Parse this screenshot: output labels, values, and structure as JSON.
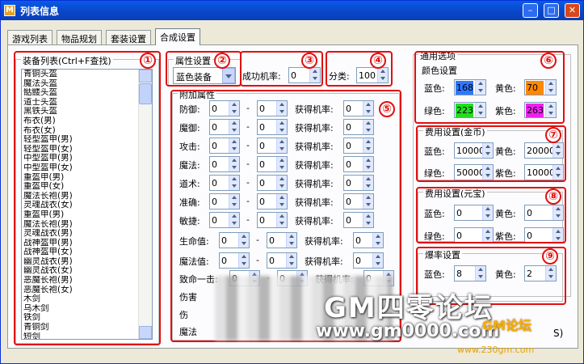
{
  "window": {
    "title": "列表信息",
    "min": "–",
    "max": "□",
    "close": "✕",
    "icon": "app-icon"
  },
  "tabs": [
    {
      "label": "游戏列表",
      "active": false
    },
    {
      "label": "物品规划",
      "active": false
    },
    {
      "label": "套装设置",
      "active": false
    },
    {
      "label": "合成设置",
      "active": true
    }
  ],
  "equip": {
    "label": "装备列表(Ctrl+F查找)",
    "items": [
      "青铜头盔",
      "魔法头盔",
      "骷髅头盔",
      "道士头盔",
      "黑铁头盔",
      "布衣(男)",
      "布衣(女)",
      "轻型盔甲(男)",
      "轻型盔甲(女)",
      "中型盔甲(男)",
      "中型盔甲(女)",
      "重盔甲(男)",
      "重盔甲(女)",
      "魔法长袍(男)",
      "灵魂战衣(女)",
      "重盔甲(男)",
      "魔法长袍(男)",
      "灵魂战衣(男)",
      "战神盔甲(男)",
      "战神盔甲(女)",
      "幽灵战衣(男)",
      "幽灵战衣(女)",
      "恶魔长袍(男)",
      "恶魔长袍(女)",
      "木剑",
      "乌木剑",
      "铁剑",
      "青铜剑",
      "短剑"
    ]
  },
  "attr": {
    "label": "属性设置",
    "combo_value": "蓝色装备"
  },
  "rate": {
    "label": "成功机率:",
    "value": "0"
  },
  "category": {
    "label": "分类:",
    "value": "100"
  },
  "extra": {
    "label": "附加属性",
    "get_label": "获得机率:",
    "rows": [
      {
        "name": "防御:",
        "a": "0",
        "b": "0",
        "p": "0"
      },
      {
        "name": "魔御:",
        "a": "0",
        "b": "0",
        "p": "0"
      },
      {
        "name": "攻击:",
        "a": "0",
        "b": "0",
        "p": "0"
      },
      {
        "name": "魔法:",
        "a": "0",
        "b": "0",
        "p": "0"
      },
      {
        "name": "道术:",
        "a": "0",
        "b": "0",
        "p": "0"
      },
      {
        "name": "准确:",
        "a": "0",
        "b": "0",
        "p": "0"
      },
      {
        "name": "敏捷:",
        "a": "0",
        "b": "0",
        "p": "0"
      },
      {
        "name": "生命值:",
        "a": "0",
        "b": "0",
        "p": "0"
      },
      {
        "name": "魔法值:",
        "a": "0",
        "b": "0",
        "p": "0"
      },
      {
        "name": "致命一击:",
        "a": "0",
        "b": "0",
        "p": "0"
      },
      {
        "name": "伤害",
        "a": "",
        "b": "",
        "p": ""
      },
      {
        "name": "伤",
        "a": "",
        "b": "",
        "p": ""
      },
      {
        "name": "魔法",
        "a": "",
        "b": "",
        "p": ""
      }
    ]
  },
  "general": {
    "label": "通用选项",
    "color_label": "颜色设置",
    "blue": {
      "label": "蓝色:",
      "value": "168",
      "color": "#2f76ff"
    },
    "yellow": {
      "label": "黄色:",
      "value": "70",
      "color": "#ff8800"
    },
    "green": {
      "label": "绿色:",
      "value": "223",
      "color": "#22dd22"
    },
    "purple": {
      "label": "紫色:",
      "value": "263",
      "color": "#ee22ee"
    }
  },
  "gold": {
    "label": "费用设置(金币)",
    "blue": {
      "label": "蓝色:",
      "value": "10000"
    },
    "yellow": {
      "label": "黄色:",
      "value": "20000"
    },
    "green": {
      "label": "绿色:",
      "value": "50000"
    },
    "purple": {
      "label": "紫色:",
      "value": "10000"
    }
  },
  "yuanbao": {
    "label": "费用设置(元宝)",
    "blue": {
      "label": "蓝色:",
      "value": "0"
    },
    "yellow": {
      "label": "黄色:",
      "value": "0"
    },
    "green": {
      "label": "绿色:",
      "value": "0"
    },
    "purple": {
      "label": "紫色:",
      "value": "0"
    }
  },
  "drop": {
    "label": "爆率设置",
    "blue": {
      "label": "蓝色:",
      "value": "8"
    },
    "yellow": {
      "label": "黄色:",
      "value": "2"
    }
  },
  "markers": [
    "①",
    "②",
    "③",
    "④",
    "⑤",
    "⑥",
    "⑦",
    "⑧",
    "⑨"
  ],
  "watermark": {
    "line1": "GM四零论坛",
    "line2": "www.gm0000.com",
    "line3": "GM论坛",
    "line4": "www.230gm.com",
    "partial": "S)"
  }
}
